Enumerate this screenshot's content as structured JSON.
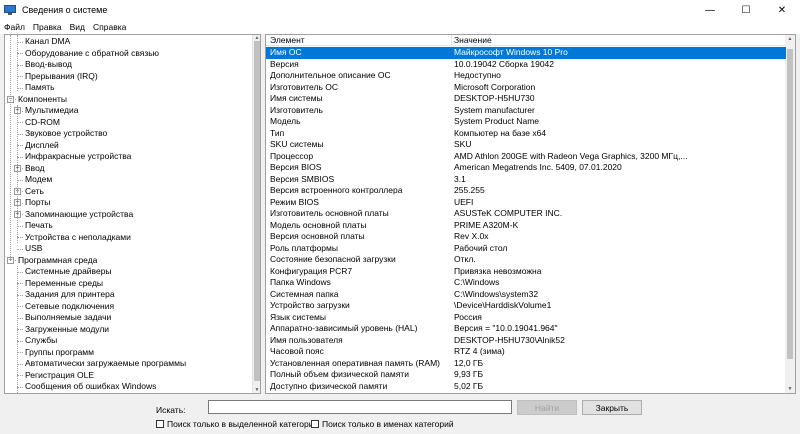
{
  "window": {
    "title": "Сведения о системе",
    "minimize_glyph": "—",
    "maximize_glyph": "☐",
    "close_glyph": "✕"
  },
  "menu": [
    "Файл",
    "Правка",
    "Вид",
    "Справка"
  ],
  "tree": [
    {
      "label": "Канал DMA",
      "level": 1,
      "expander": null
    },
    {
      "label": "Оборудование с обратной связью",
      "level": 1,
      "expander": null
    },
    {
      "label": "Ввод-вывод",
      "level": 1,
      "expander": null
    },
    {
      "label": "Прерывания (IRQ)",
      "level": 1,
      "expander": null
    },
    {
      "label": "Память",
      "level": 1,
      "expander": null
    },
    {
      "label": "Компоненты",
      "level": 0,
      "expander": "minus"
    },
    {
      "label": "Мультимедиа",
      "level": 1,
      "expander": "plus"
    },
    {
      "label": "CD-ROM",
      "level": 1,
      "expander": null
    },
    {
      "label": "Звуковое устройство",
      "level": 1,
      "expander": null
    },
    {
      "label": "Дисплей",
      "level": 1,
      "expander": null
    },
    {
      "label": "Инфракрасные устройства",
      "level": 1,
      "expander": null
    },
    {
      "label": "Ввод",
      "level": 1,
      "expander": "plus"
    },
    {
      "label": "Модем",
      "level": 1,
      "expander": null
    },
    {
      "label": "Сеть",
      "level": 1,
      "expander": "plus"
    },
    {
      "label": "Порты",
      "level": 1,
      "expander": "plus"
    },
    {
      "label": "Запоминающие устройства",
      "level": 1,
      "expander": "plus"
    },
    {
      "label": "Печать",
      "level": 1,
      "expander": null
    },
    {
      "label": "Устройства с неполадками",
      "level": 1,
      "expander": null
    },
    {
      "label": "USB",
      "level": 1,
      "expander": null
    },
    {
      "label": "Программная среда",
      "level": 0,
      "expander": "minus"
    },
    {
      "label": "Системные драйверы",
      "level": 1,
      "expander": null
    },
    {
      "label": "Переменные среды",
      "level": 1,
      "expander": null
    },
    {
      "label": "Задания для принтера",
      "level": 1,
      "expander": null
    },
    {
      "label": "Сетевые подключения",
      "level": 1,
      "expander": null
    },
    {
      "label": "Выполняемые задачи",
      "level": 1,
      "expander": null
    },
    {
      "label": "Загруженные модули",
      "level": 1,
      "expander": null
    },
    {
      "label": "Службы",
      "level": 1,
      "expander": null
    },
    {
      "label": "Группы программ",
      "level": 1,
      "expander": null
    },
    {
      "label": "Автоматически загружаемые программы",
      "level": 1,
      "expander": null
    },
    {
      "label": "Регистрация OLE",
      "level": 1,
      "expander": null
    },
    {
      "label": "Сообщения об ошибках Windows",
      "level": 1,
      "expander": null
    }
  ],
  "table": {
    "headers": {
      "element": "Элемент",
      "value": "Значение"
    },
    "selected_index": 0,
    "rows": [
      [
        "Имя ОС",
        "Майкрософт Windows 10 Pro"
      ],
      [
        "Версия",
        "10.0.19042 Сборка 19042"
      ],
      [
        "Дополнительное описание ОС",
        "Недоступно"
      ],
      [
        "Изготовитель ОС",
        "Microsoft Corporation"
      ],
      [
        "Имя системы",
        "DESKTOP-H5HU730"
      ],
      [
        "Изготовитель",
        "System manufacturer"
      ],
      [
        "Модель",
        "System Product Name"
      ],
      [
        "Тип",
        "Компьютер на базе x64"
      ],
      [
        "SKU системы",
        "SKU"
      ],
      [
        "Процессор",
        "AMD Athlon 200GE with Radeon Vega Graphics, 3200 МГц,..."
      ],
      [
        "Версия BIOS",
        "American Megatrends Inc. 5409, 07.01.2020"
      ],
      [
        "Версия SMBIOS",
        "3.1"
      ],
      [
        "Версия встроенного контроллера",
        "255.255"
      ],
      [
        "Режим BIOS",
        "UEFI"
      ],
      [
        "Изготовитель основной платы",
        "ASUSTeK COMPUTER INC."
      ],
      [
        "Модель основной платы",
        "PRIME A320M-K"
      ],
      [
        "Версия основной платы",
        "Rev X.0x"
      ],
      [
        "Роль платформы",
        "Рабочий стол"
      ],
      [
        "Состояние безопасной загрузки",
        "Откл."
      ],
      [
        "Конфигурация PCR7",
        "Привязка невозможна"
      ],
      [
        "Папка Windows",
        "C:\\Windows"
      ],
      [
        "Системная папка",
        "C:\\Windows\\system32"
      ],
      [
        "Устройство загрузки",
        "\\Device\\HarddiskVolume1"
      ],
      [
        "Язык системы",
        "Россия"
      ],
      [
        "Аппаратно-зависимый уровень (HAL)",
        "Версия = \"10.0.19041.964\""
      ],
      [
        "Имя пользователя",
        "DESKTOP-H5HU730\\Alnik52"
      ],
      [
        "Часовой пояс",
        "RTZ 4 (зима)"
      ],
      [
        "Установленная оперативная память (RAM)",
        "12,0 ГБ"
      ],
      [
        "Полный объем физической памяти",
        "9,93 ГБ"
      ],
      [
        "Доступно физической памяти",
        "5,02 ГБ"
      ]
    ]
  },
  "search": {
    "label": "Искать:",
    "value": "",
    "find_button": "Найти",
    "close_button": "Закрыть",
    "checkbox_selected_category": "Поиск только в выделенной категории",
    "checkbox_category_names": "Поиск только в именах категорий"
  },
  "colors": {
    "selection": "#0078d7",
    "window_bg": "#f0f0f0"
  }
}
